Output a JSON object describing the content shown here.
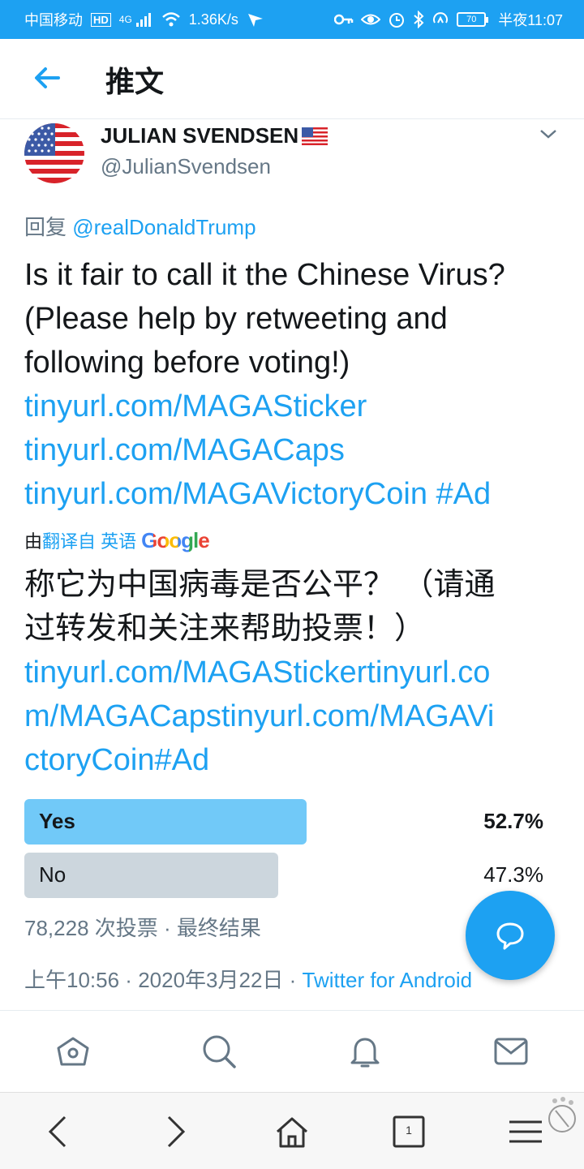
{
  "status_bar": {
    "carrier": "中国移动",
    "hd": "HD",
    "network": "4G",
    "speed": "1.36K/s",
    "battery": "70",
    "time": "半夜11:07"
  },
  "header": {
    "title": "推文"
  },
  "tweet": {
    "author_name": "JULIAN SVENDSEN",
    "author_handle": "@JulianSvendsen",
    "reply_prefix": "回复",
    "reply_to": "@realDonaldTrump",
    "text_line1": "Is it fair to call it the Chinese Virus?",
    "text_line2": "(Please help by retweeting and",
    "text_line3": "following before voting!)",
    "link1": "tinyurl.com/MAGASticker",
    "link2": "tinyurl.com/MAGACaps",
    "link3": "tinyurl.com/MAGAVictoryCoin",
    "hashtag": "#Ad",
    "translated_by_prefix": "由",
    "translated_by_link": "翻译自 英语",
    "translated_service": "Google",
    "translation_line1": "称它为中国病毒是否公平？ （请通",
    "translation_line2": "过转发和关注来帮助投票！）",
    "translation_link1": "tinyurl.com/MAGAStickertinyurl.co",
    "translation_link2": "m/MAGACapstinyurl.com/MAGAVi",
    "translation_link3": "ctoryCoin#Ad"
  },
  "poll": {
    "options": [
      {
        "label": "Yes",
        "percent_text": "52.7%",
        "percent": 52.7,
        "color": "#71c9f8",
        "winner": true
      },
      {
        "label": "No",
        "percent_text": "47.3%",
        "percent": 47.3,
        "color": "#ccd6dd",
        "winner": false
      }
    ],
    "votes": "78,228 次投票",
    "status": "最终结果"
  },
  "meta": {
    "time": "上午10:56",
    "date": "2020年3月22日",
    "source": "Twitter for Android"
  },
  "colors": {
    "accent": "#1da1f2",
    "secondary_text": "#657786"
  },
  "tabs": [
    "home-icon",
    "search-icon",
    "notifications-icon",
    "messages-icon"
  ],
  "nav": [
    "back-icon",
    "forward-icon",
    "home-icon",
    "tabs-icon",
    "menu-icon"
  ],
  "nav_tab_count": "1"
}
